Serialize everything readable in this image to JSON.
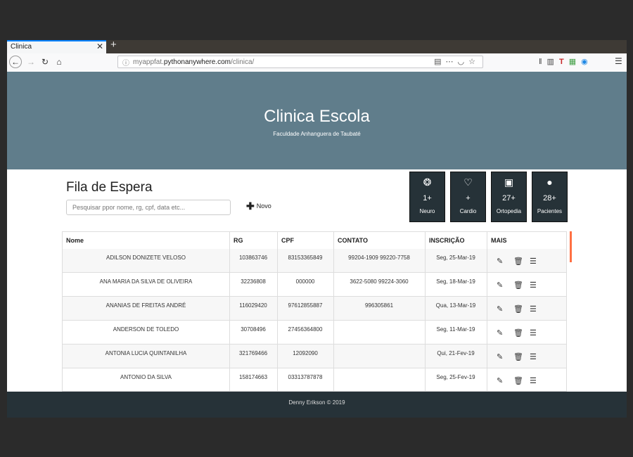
{
  "browser": {
    "tab_title": "Clinica",
    "tab_close": "✕",
    "new_tab": "+",
    "url_prefix": "myappfat.",
    "url_domain": "pythonanywhere.com",
    "url_path": "/clinica/"
  },
  "hero": {
    "title": "Clinica Escola",
    "subtitle": "Faculdade Anhanguera de Taubaté"
  },
  "queue": {
    "title": "Fila de Espera",
    "search_placeholder": "Pesquisar ppor nome, rg, cpf, data etc...",
    "new_label": "Novo"
  },
  "stats": [
    {
      "icon": "brain-icon",
      "value": "1+",
      "label": "Neuro"
    },
    {
      "icon": "heartbeat-icon",
      "value": "+",
      "label": "Cardio"
    },
    {
      "icon": "xray-icon",
      "value": "27+",
      "label": "Ortopedia"
    },
    {
      "icon": "user-icon",
      "value": "28+",
      "label": "Pacientes"
    }
  ],
  "table": {
    "headers": [
      "Nome",
      "RG",
      "CPF",
      "CONTATO",
      "INSCRIÇÃO",
      "MAIS"
    ],
    "rows": [
      {
        "nome": "ADILSON DONIZETE VELOSO",
        "rg": "103863746",
        "cpf": "83153365849",
        "contato": "99204-1909 99220-7758",
        "inscricao": "Seg, 25-Mar-19"
      },
      {
        "nome": "ANA MARIA DA SILVA DE OLIVEIRA",
        "rg": "32236808",
        "cpf": "000000",
        "contato": "3622-5080 99224-3060",
        "inscricao": "Seg, 18-Mar-19"
      },
      {
        "nome": "ANANIAS DE FREITAS ANDRÉ",
        "rg": "116029420",
        "cpf": "97612855887",
        "contato": "996305861",
        "inscricao": "Qua, 13-Mar-19"
      },
      {
        "nome": "ANDERSON DE TOLEDO",
        "rg": "30708496",
        "cpf": "27456364800",
        "contato": "",
        "inscricao": "Seg, 11-Mar-19"
      },
      {
        "nome": "ANTONIA LUCIA QUINTANILHA",
        "rg": "321769466",
        "cpf": "12092090",
        "contato": "",
        "inscricao": "Qui, 21-Fev-19"
      },
      {
        "nome": "ANTONIO DA SILVA",
        "rg": "158174663",
        "cpf": "03313787878",
        "contato": "",
        "inscricao": "Seg, 25-Fev-19"
      }
    ]
  },
  "footer": {
    "text": "Denny Erikson © 2019"
  }
}
